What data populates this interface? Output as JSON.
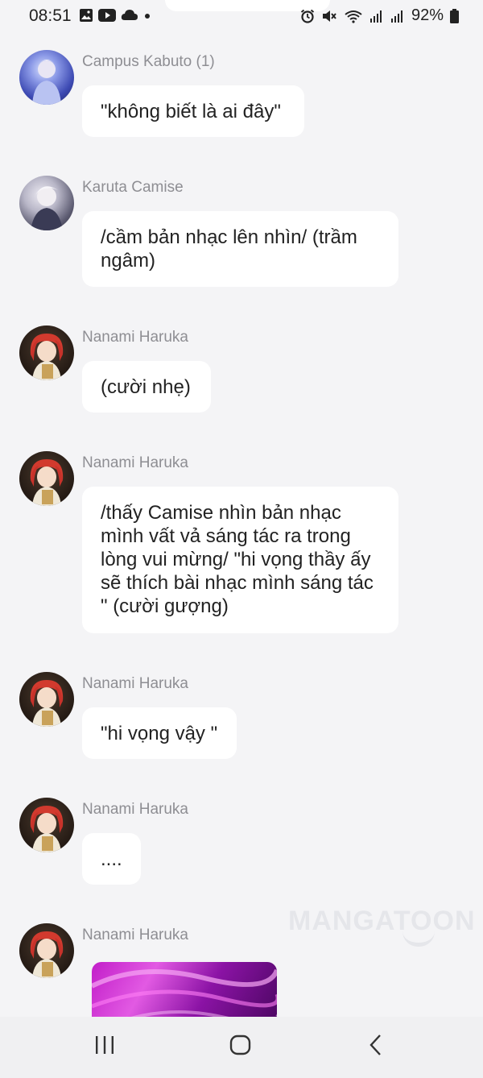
{
  "status_bar": {
    "time": "08:51",
    "battery": "92%"
  },
  "messages": [
    {
      "name": "Campus Kabuto (1)",
      "avatar": "avatar-icon",
      "text": "\"không biết là ai đây\""
    },
    {
      "name": "Karuta Camise",
      "avatar": "avatar-icon",
      "text": "/cầm bản nhạc lên nhìn/ (trầm ngâm)"
    },
    {
      "name": "Nanami Haruka",
      "avatar": "avatar-icon",
      "text": "(cười nhẹ)"
    },
    {
      "name": "Nanami Haruka",
      "avatar": "avatar-icon",
      "text": "/thấy Camise nhìn bản nhạc mình vất vả sáng tác ra trong lòng vui mừng/ \"hi vọng thầy ấy sẽ thích bài nhạc mình sáng tác \" (cười gượng)"
    },
    {
      "name": "Nanami Haruka",
      "avatar": "avatar-icon",
      "text": "\"hi vọng vậy \""
    },
    {
      "name": "Nanami Haruka",
      "avatar": "avatar-icon",
      "text": "...."
    },
    {
      "name": "Nanami Haruka",
      "avatar": "avatar-icon",
      "text": ""
    }
  ],
  "watermark": "MANGATOON",
  "nav": {
    "recents": "recents-icon",
    "home": "home-icon",
    "back": "back-icon"
  }
}
